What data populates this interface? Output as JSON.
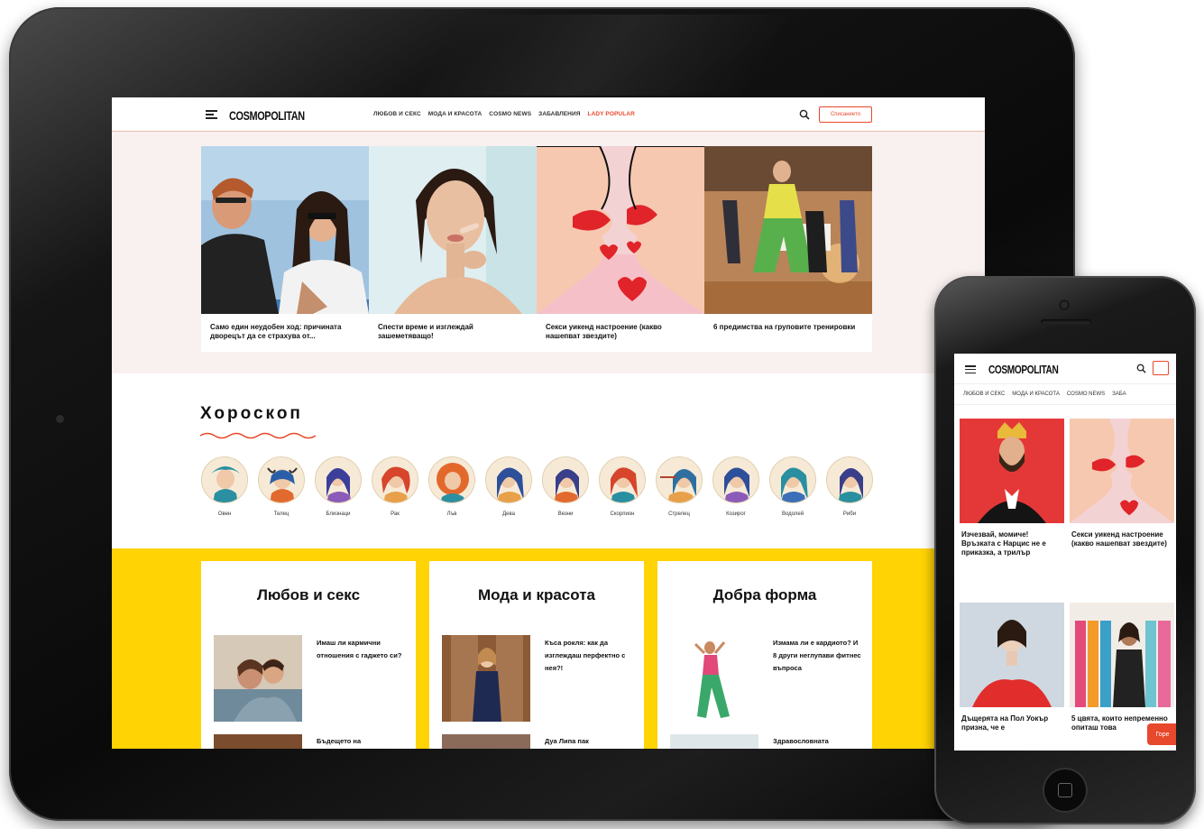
{
  "tablet": {
    "header": {
      "logo": "COSMOPOLITAN",
      "nav": [
        "ЛЮБОВ И СЕКС",
        "МОДА И КРАСОТА",
        "COSMO NEWS",
        "ЗАБАВЛЕНИЯ",
        "LADY POPULAR"
      ],
      "subscribe_label": "Списанието"
    },
    "featured": [
      {
        "caption": "Само един неудобен ход: причината дворецът да се страхува от..."
      },
      {
        "caption": "Спести време и изглеждай зашеметяващо!"
      },
      {
        "caption": "Секси уикенд настроение (какво нашепват звездите)"
      },
      {
        "caption": "6 предимства на груповите тренировки"
      }
    ],
    "horoscope": {
      "title": "Хороскоп",
      "signs": [
        "Овен",
        "Телец",
        "Близнаци",
        "Рак",
        "Лъв",
        "Дева",
        "Везни",
        "Скорпион",
        "Стрелец",
        "Козирог",
        "Водолей",
        "Риби"
      ]
    },
    "sections": [
      {
        "title": "Любов и секс",
        "article": "Имаш ли кармични отношения с гаджето си?",
        "article2": "Бъдещето на"
      },
      {
        "title": "Мода и красота",
        "article": "Къса рокля: как да изглеждаш перфектно с нея?!",
        "article2": "Дуа Липа пак"
      },
      {
        "title": "Добра форма",
        "article": "Измама ли е кардиото? И 8 други неглупави фитнес въпроса",
        "article2": "Здравословната"
      }
    ]
  },
  "phone": {
    "header": {
      "logo": "COSMOPOLITAN"
    },
    "nav": [
      "ЛЮБОВ И СЕКС",
      "МОДА И КРАСОТА",
      "COSMO NEWS",
      "ЗАБА"
    ],
    "cards": [
      {
        "caption": "Изчезвай, момиче! Връзката с Нарцис не е приказка, а трилър"
      },
      {
        "caption": "Секси уикенд настроение (какво нашепват звездите)"
      },
      {
        "caption": "Дъщерята на Пол Уокър призна, че е"
      },
      {
        "caption": "5 цвята, които непременно опиташ това"
      }
    ],
    "top_button": "Горе"
  },
  "colors": {
    "accent": "#e8482c",
    "yellow": "#ffd304",
    "band": "#f8f1f0"
  }
}
